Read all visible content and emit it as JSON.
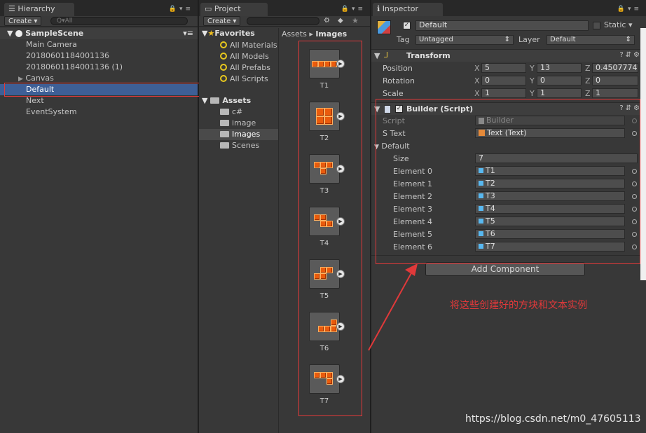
{
  "hierarchy": {
    "tab_label": "Hierarchy",
    "create_label": "Create ▾",
    "search_placeholder": "Q▾All",
    "scene_name": "SampleScene",
    "items": [
      "Main Camera",
      "20180601184001136",
      "20180601184001136 (1)",
      "Canvas",
      "Default",
      "Next",
      "EventSystem"
    ]
  },
  "project": {
    "tab_label": "Project",
    "create_label": "Create ▾",
    "favorites_label": "Favorites",
    "favorites": [
      "All Materials",
      "All Models",
      "All Prefabs",
      "All Scripts"
    ],
    "assets_label": "Assets",
    "folders": [
      "c#",
      "image",
      "Images",
      "Scenes"
    ],
    "breadcrumb_root": "Assets",
    "breadcrumb_sep": "▸",
    "breadcrumb_current": "Images",
    "prefabs": [
      "T1",
      "T2",
      "T3",
      "T4",
      "T5",
      "T6",
      "T7"
    ]
  },
  "inspector": {
    "tab_label": "Inspector",
    "object_name": "Default",
    "static_label": "Static",
    "tag_label": "Tag",
    "tag_value": "Untagged",
    "layer_label": "Layer",
    "layer_value": "Default",
    "transform": {
      "title": "Transform",
      "position_label": "Position",
      "rotation_label": "Rotation",
      "scale_label": "Scale",
      "position": [
        "5",
        "13",
        "0.4507774"
      ],
      "rotation": [
        "0",
        "0",
        "0"
      ],
      "scale": [
        "1",
        "1",
        "1"
      ]
    },
    "builder": {
      "title": "Builder (Script)",
      "script_label": "Script",
      "script_value": "Builder",
      "stext_label": "S Text",
      "stext_value": "Text (Text)",
      "default_label": "Default",
      "size_label": "Size",
      "size_value": "7",
      "elements": [
        {
          "label": "Element 0",
          "value": "T1"
        },
        {
          "label": "Element 1",
          "value": "T2"
        },
        {
          "label": "Element 2",
          "value": "T3"
        },
        {
          "label": "Element 3",
          "value": "T4"
        },
        {
          "label": "Element 4",
          "value": "T5"
        },
        {
          "label": "Element 5",
          "value": "T6"
        },
        {
          "label": "Element 6",
          "value": "T7"
        }
      ]
    },
    "add_component_label": "Add Component"
  },
  "annotation": {
    "text": "将这些创建好的方块和文本实例",
    "color": "#e0393a"
  },
  "watermark": "https://blog.csdn.net/m0_47605113",
  "colors": {
    "selection": "#3e5f96",
    "annotation": "#e0393a",
    "accent_orange": "#ea5b0c"
  }
}
